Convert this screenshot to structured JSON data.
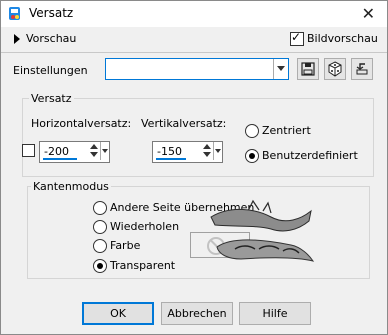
{
  "window": {
    "title": "Versatz",
    "close_symbol": "✕"
  },
  "preview_row": {
    "expand_label": "Vorschau",
    "bildvorschau_label": "Bildvorschau",
    "bildvorschau_checked": true
  },
  "presets": {
    "label": "Einstellungen",
    "value": ""
  },
  "versatz": {
    "legend": "Versatz",
    "horizontal_label": "Horizontalversatz:",
    "horizontal_value": "-200",
    "vertical_label": "Vertikalversatz:",
    "vertical_value": "-150",
    "link_checked": false,
    "options": [
      {
        "label": "Zentriert",
        "selected": false
      },
      {
        "label": "Benutzerdefiniert",
        "selected": true
      }
    ]
  },
  "kantenmodus": {
    "legend": "Kantenmodus",
    "options": [
      {
        "label": "Andere Seite übernehmen",
        "selected": false
      },
      {
        "label": "Wiederholen",
        "selected": false
      },
      {
        "label": "Farbe",
        "selected": false
      },
      {
        "label": "Transparent",
        "selected": true
      }
    ]
  },
  "buttons": {
    "ok": "OK",
    "cancel": "Abbrechen",
    "help": "Hilfe"
  },
  "colors": {
    "accent": "#0078d7",
    "dialog_bg": "#f0f0f0",
    "group_border": "#d5d5d5",
    "button_bg": "#e1e1e1"
  }
}
